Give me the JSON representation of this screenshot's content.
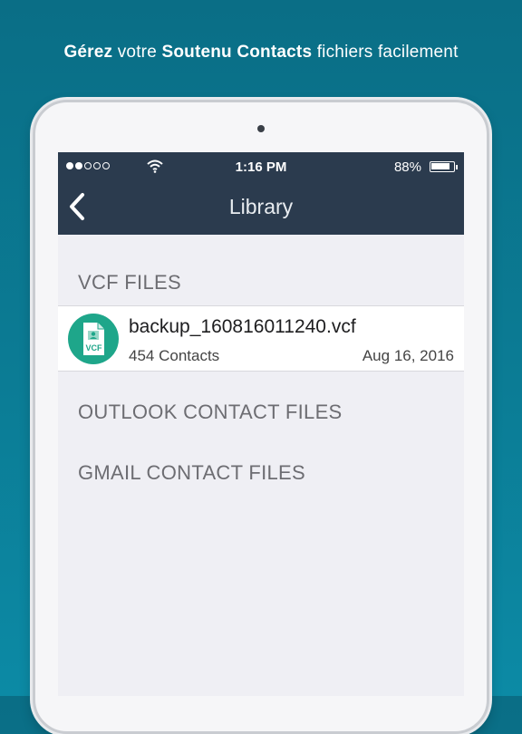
{
  "headline": {
    "part1_bold": "Gérez",
    "part2": " votre ",
    "part3_bold": "Soutenu Contacts",
    "part4": " fichiers facilement"
  },
  "status_bar": {
    "signal_dots_filled": 2,
    "signal_dots_total": 5,
    "time": "1:16 PM",
    "battery_percent": "88%",
    "battery_level": 0.88
  },
  "navbar": {
    "title": "Library",
    "back_icon": "chevron-left-icon"
  },
  "sections": {
    "vcf": "VCF FILES",
    "outlook": "OUTLOOK CONTACT FILES",
    "gmail": "GMAIL CONTACT FILES"
  },
  "files": [
    {
      "name": "backup_160816011240.vcf",
      "contacts": "454 Contacts",
      "date": "Aug 16, 2016",
      "icon_label": "VCF",
      "icon": "vcf-file-icon"
    }
  ],
  "colors": {
    "background": "#0b7c95",
    "navbar": "#2b3b4e",
    "icon_green": "#1ea68a",
    "section_text": "#6d6d72"
  }
}
